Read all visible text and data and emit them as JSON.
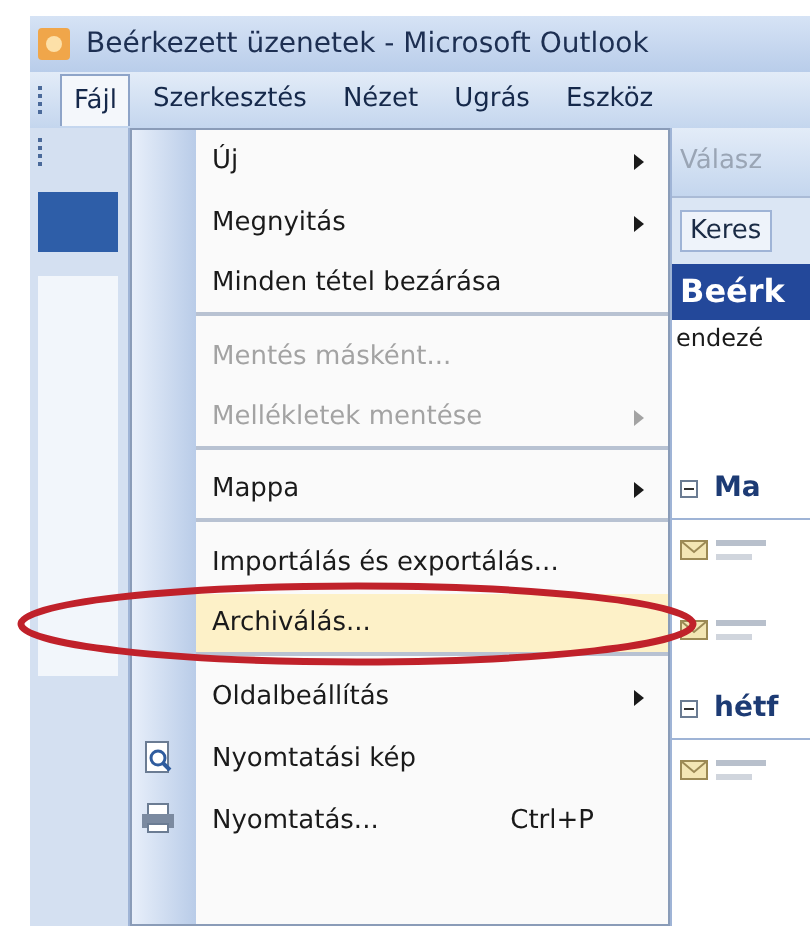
{
  "window": {
    "title": "Beérkezett üzenetek - Microsoft Outlook"
  },
  "menubar": [
    {
      "label": "Fájl",
      "selected": true
    },
    {
      "label": "Szerkesztés",
      "selected": false
    },
    {
      "label": "Nézet",
      "selected": false
    },
    {
      "label": "Ugrás",
      "selected": false
    },
    {
      "label": "Eszköz",
      "selected": false
    }
  ],
  "menu": [
    {
      "label": "Új",
      "kind": "plain",
      "submenu": true,
      "disabled": false,
      "separator_after": false,
      "highlighted": false
    },
    {
      "label": "Megnyitás",
      "kind": "plain",
      "submenu": true,
      "disabled": false,
      "separator_after": false,
      "highlighted": false
    },
    {
      "label": "Minden tétel bezárása",
      "kind": "plain",
      "submenu": false,
      "disabled": false,
      "separator_after": true,
      "highlighted": false
    },
    {
      "label": "Mentés másként...",
      "kind": "plain",
      "submenu": false,
      "disabled": true,
      "separator_after": false,
      "highlighted": false
    },
    {
      "label": "Mellékletek mentése",
      "kind": "plain",
      "submenu": true,
      "disabled": true,
      "separator_after": true,
      "highlighted": false
    },
    {
      "label": "Mappa",
      "kind": "plain",
      "submenu": true,
      "disabled": false,
      "separator_after": true,
      "highlighted": false
    },
    {
      "label": "Importálás és exportálás...",
      "kind": "plain",
      "submenu": false,
      "disabled": false,
      "separator_after": false,
      "highlighted": false
    },
    {
      "label": "Archiválás...",
      "kind": "plain",
      "submenu": false,
      "disabled": false,
      "separator_after": true,
      "highlighted": true
    },
    {
      "label": "Oldalbeállítás",
      "kind": "plain",
      "submenu": true,
      "disabled": false,
      "separator_after": false,
      "highlighted": false
    },
    {
      "label": "Nyomtatási kép",
      "kind": "preview",
      "submenu": false,
      "disabled": false,
      "separator_after": false,
      "highlighted": false
    },
    {
      "label": "Nyomtatás...",
      "kind": "print",
      "submenu": false,
      "disabled": false,
      "separator_after": false,
      "highlighted": false,
      "shortcut": "Ctrl+P"
    }
  ],
  "toolbar": {
    "reply_button": "Válasz",
    "search_button": "Keres"
  },
  "folder_header": "Beérk",
  "arrange_label": "endezé",
  "groups": [
    {
      "label": "Ma",
      "expanded": true,
      "messages": [
        {
          "kind": "mail"
        },
        {
          "kind": "mail"
        }
      ]
    },
    {
      "label": "hétf",
      "expanded": true,
      "messages": [
        {
          "kind": "mail"
        }
      ]
    }
  ]
}
